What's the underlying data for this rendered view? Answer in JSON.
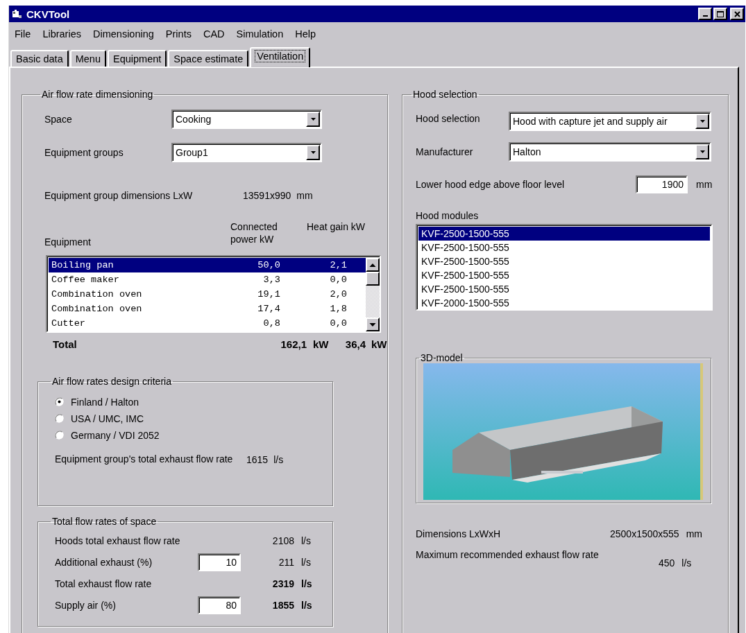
{
  "window": {
    "title": "CKVTool"
  },
  "menu": [
    "File",
    "Libraries",
    "Dimensioning",
    "Prints",
    "CAD",
    "Simulation",
    "Help"
  ],
  "tabs": [
    {
      "label": "Basic data",
      "selected": false
    },
    {
      "label": "Menu",
      "selected": false
    },
    {
      "label": "Equipment",
      "selected": false
    },
    {
      "label": "Space estimate",
      "selected": false
    },
    {
      "label": "Ventilation",
      "selected": true
    }
  ],
  "air_flow": {
    "title": "Air flow rate dimensioning",
    "space": {
      "label": "Space",
      "value": "Cooking"
    },
    "equipment_groups": {
      "label": "Equipment groups",
      "value": "Group1"
    },
    "group_dimensions": {
      "label": "Equipment group dimensions LxW",
      "value": "13591x990",
      "unit": "mm"
    },
    "equipment_table": {
      "columns": [
        "Equipment",
        "Connected power kW",
        "Heat gain kW"
      ],
      "rows": [
        {
          "name": "Boiling pan",
          "power": "50,0",
          "heat": "2,1",
          "selected": true
        },
        {
          "name": "Coffee maker",
          "power": "3,3",
          "heat": "0,0",
          "selected": false
        },
        {
          "name": "Combination oven",
          "power": "19,1",
          "heat": "2,0",
          "selected": false
        },
        {
          "name": "Combination oven",
          "power": "17,4",
          "heat": "1,8",
          "selected": false
        },
        {
          "name": "Cutter",
          "power": "0,8",
          "heat": "0,0",
          "selected": false
        }
      ]
    },
    "total": {
      "label": "Total",
      "power": "162,1",
      "power_unit": "kW",
      "heat": "36,4",
      "heat_unit": "kW"
    },
    "criteria": {
      "title": "Air flow rates design criteria",
      "options": [
        {
          "label": "Finland / Halton",
          "selected": true
        },
        {
          "label": "USA / UMC, IMC",
          "selected": false
        },
        {
          "label": "Germany / VDI 2052",
          "selected": false
        }
      ],
      "exhaust": {
        "label": "Equipment group's total exhaust flow rate",
        "value": "1615",
        "unit": "l/s"
      }
    },
    "totals": {
      "title": "Total flow rates of space",
      "rows": [
        {
          "label": "Hoods total exhaust flow rate",
          "value": "2108",
          "unit": "l/s",
          "bold": false
        },
        {
          "label": "Additional exhaust (%)",
          "input": "10",
          "value": "211",
          "unit": "l/s",
          "bold": false
        },
        {
          "label": "Total exhaust flow rate",
          "value": "2319",
          "unit": "l/s",
          "bold": true
        },
        {
          "label": "Supply air (%)",
          "input": "80",
          "value": "1855",
          "unit": "l/s",
          "bold": true
        }
      ]
    }
  },
  "hood": {
    "title": "Hood selection",
    "hood_selection": {
      "label": "Hood selection",
      "value": "Hood with capture jet and supply air"
    },
    "manufacturer": {
      "label": "Manufacturer",
      "value": "Halton"
    },
    "lower_edge": {
      "label": "Lower hood edge above floor level",
      "value": "1900",
      "unit": "mm"
    },
    "modules": {
      "label": "Hood modules",
      "items": [
        {
          "text": "KVF-2500-1500-555",
          "selected": true
        },
        {
          "text": "KVF-2500-1500-555",
          "selected": false
        },
        {
          "text": "KVF-2500-1500-555",
          "selected": false
        },
        {
          "text": "KVF-2500-1500-555",
          "selected": false
        },
        {
          "text": "KVF-2500-1500-555",
          "selected": false
        },
        {
          "text": "KVF-2000-1500-555",
          "selected": false
        }
      ]
    },
    "model": {
      "title": "3D-model"
    },
    "dimensions": {
      "label": "Dimensions LxWxH",
      "value": "2500x1500x555",
      "unit": "mm"
    },
    "max_exhaust": {
      "label": "Maximum recommended exhaust flow rate",
      "value": "450",
      "unit": "l/s"
    }
  }
}
